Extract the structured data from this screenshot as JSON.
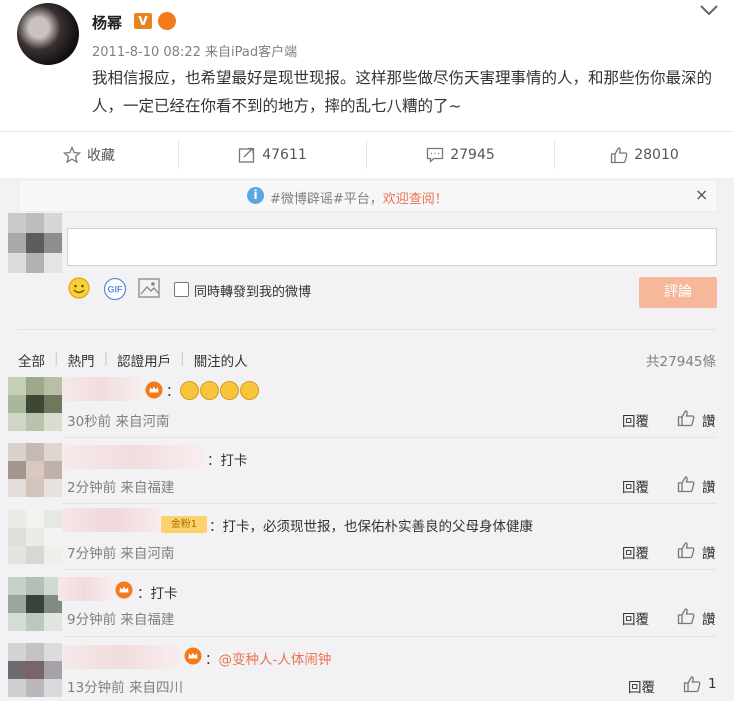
{
  "post": {
    "author": "杨幂",
    "verified_badge": "V",
    "timestamp": "2011-8-10 08:22",
    "source": "来自iPad客户端",
    "content": "我相信报应，也希望最好是现世现报。这样那些做尽伤天害理事情的人，和那些伤你最深的人，一定已经在你看不到的地方，摔的乱七八糟的了~"
  },
  "actions": {
    "favorite_label": "收藏",
    "repost_count": "47611",
    "comment_count": "27945",
    "like_count": "28010"
  },
  "notice": {
    "topic": "#微博辟谣#平台，",
    "welcome": "欢迎查阅！",
    "close": "×"
  },
  "composer": {
    "repost_checkbox_label": "同時轉發到我的微博",
    "submit_label": "評論",
    "gif_label": "GIF"
  },
  "tabs": {
    "all": "全部",
    "hot": "熱門",
    "verified": "認證用戶",
    "following": "關注的人",
    "total": "共27945條"
  },
  "comments": [
    {
      "text": "：",
      "time": "30秒前 来自河南",
      "reply": "回覆",
      "like": "讚"
    },
    {
      "text": "：打卡",
      "time": "2分钟前 来自福建",
      "reply": "回覆",
      "like": "讚"
    },
    {
      "badge": "金粉1",
      "text": "：打卡，必须现世报，也保佑朴实善良的父母身体健康",
      "time": "7分钟前 来自河南",
      "reply": "回覆",
      "like": "讚"
    },
    {
      "text": "：打卡",
      "time": "9分钟前 来自福建",
      "reply": "回覆",
      "like": "讚"
    },
    {
      "text": "：",
      "mention": "@变种人-人体闹钟",
      "time": "13分钟前 来自四川",
      "reply": "回覆",
      "like": "1"
    }
  ],
  "colors": {
    "accent": "#eb7350",
    "submit_bg": "#f6b79b",
    "panel_bg": "#f2f2f5",
    "vip_orange": "#e8841f"
  }
}
